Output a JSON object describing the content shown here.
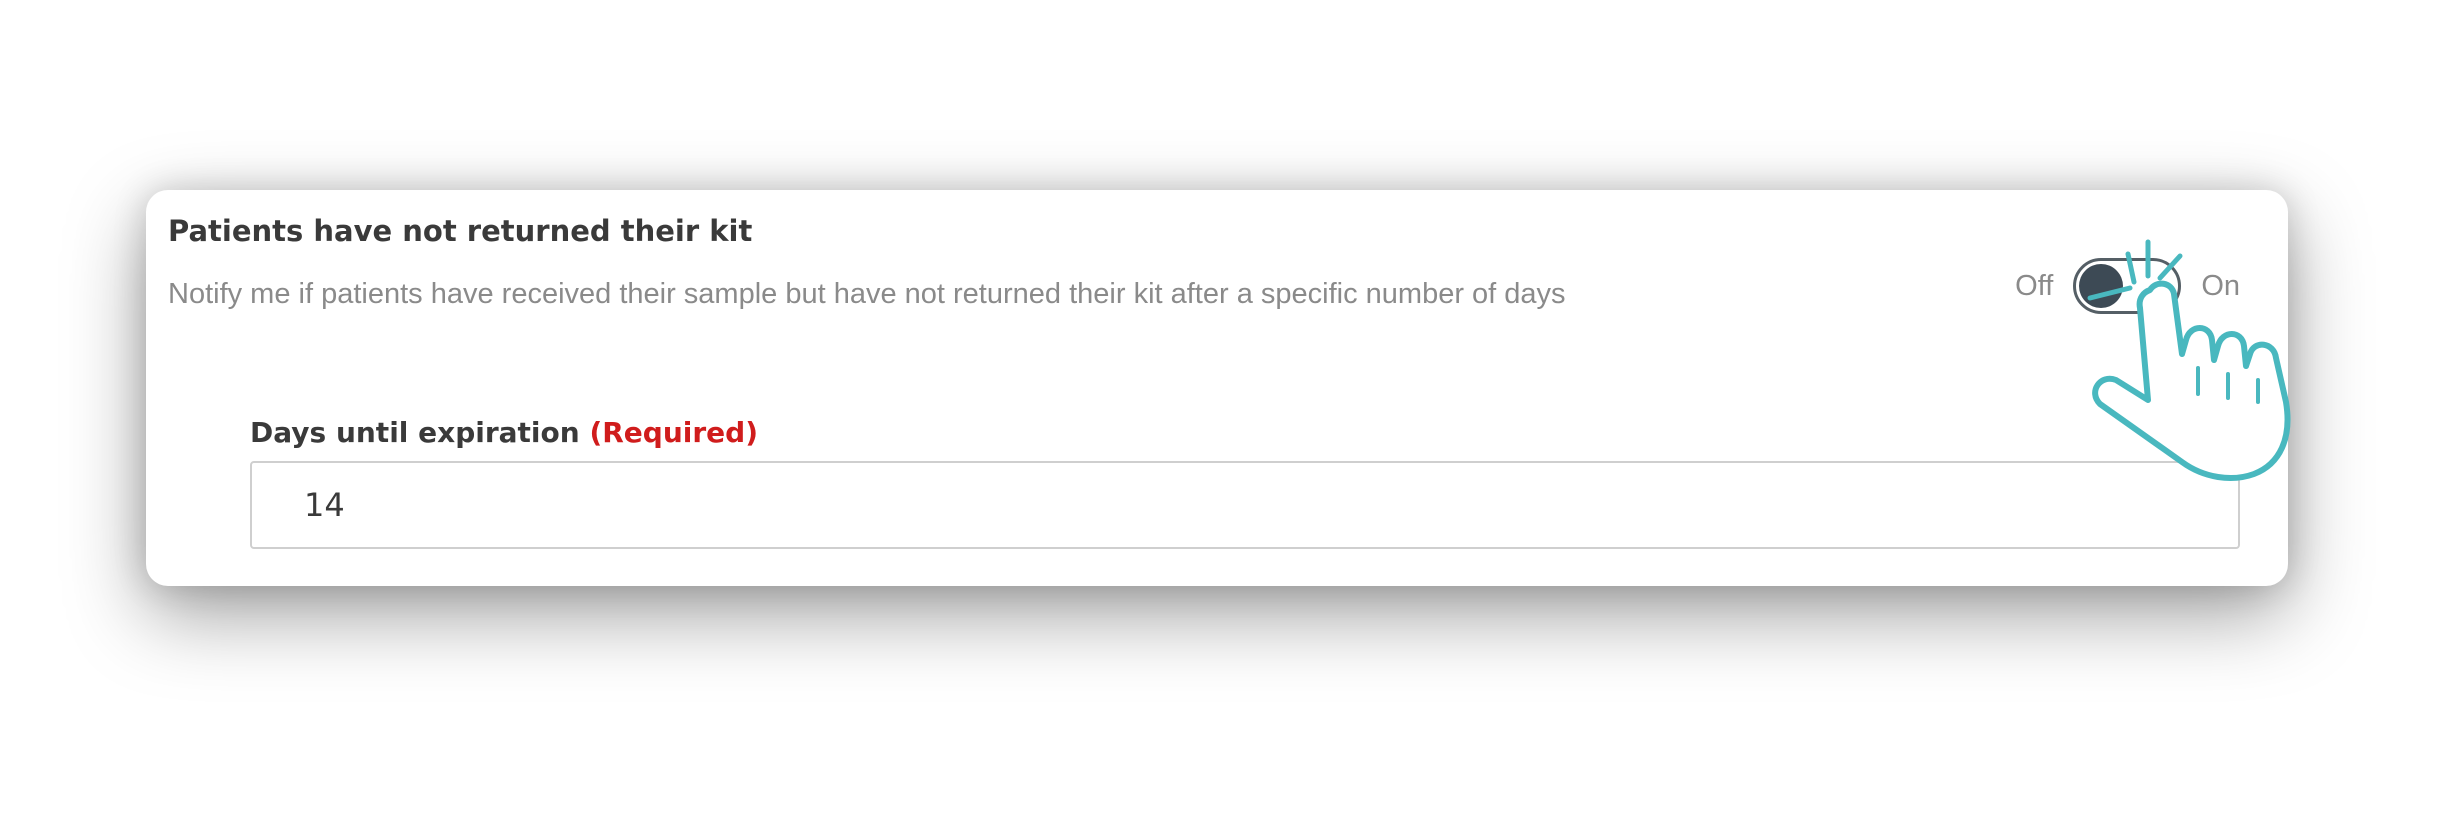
{
  "setting": {
    "title": "Patients have not returned their kit",
    "description": "Notify me if patients have received their sample but have not returned their kit after a specific number of days",
    "toggle": {
      "off_label": "Off",
      "on_label": "On",
      "state": "off"
    }
  },
  "field": {
    "label": "Days until expiration",
    "required_label": "(Required)",
    "value": "14"
  },
  "colors": {
    "accent_cursor": "#49b8bf",
    "required": "#d01c1c",
    "switch_knob": "#3d4a55"
  },
  "icons": {
    "cursor": "pointing-hand-icon"
  }
}
